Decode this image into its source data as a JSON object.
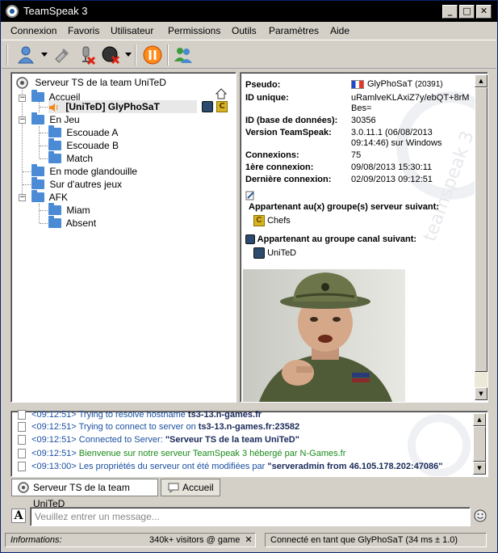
{
  "window": {
    "title": "TeamSpeak 3"
  },
  "menu": [
    "Connexion",
    "Favoris",
    "Utilisateur",
    "Permissions",
    "Outils",
    "Paramètres",
    "Aide"
  ],
  "tree": {
    "server": "Serveur TS de la team UniTeD",
    "channels": [
      {
        "name": "Accueil"
      },
      {
        "name": "[UniTeD] GlyPhoSaT",
        "client": true
      },
      {
        "name": "En Jeu"
      },
      {
        "name": "Escouade A"
      },
      {
        "name": "Escouade B"
      },
      {
        "name": "Match"
      },
      {
        "name": "En mode glandouille"
      },
      {
        "name": "Sur d'autres jeux"
      },
      {
        "name": "AFK"
      },
      {
        "name": "Miam"
      },
      {
        "name": "Absent"
      }
    ],
    "client_badge": "C"
  },
  "info": {
    "labels": {
      "pseudo": "Pseudo:",
      "uid": "ID unique:",
      "dbid": "ID (base de données):",
      "version": "Version TeamSpeak:",
      "connections": "Connexions:",
      "first": "1ère connexion:",
      "last": "Dernière connexion:"
    },
    "pseudo": "GlyPhoSaT",
    "pseudo_id": "(20391)",
    "uid_line1": "uRamlveKLAxiZ7y/ebQT+8rM",
    "uid_line2": "Bes=",
    "dbid": "30356",
    "version_line1": "3.0.11.1 (06/08/2013",
    "version_line2": "09:14:46) sur Windows",
    "connections": "75",
    "first": "09/08/2013 15:30:11",
    "last": "02/09/2013 09:12:51",
    "server_groups_title": "Appartenant au(x) groupe(s) serveur suivant:",
    "server_group": "Chefs",
    "channel_group_title": "Appartenant au groupe canal suivant:",
    "channel_group": "UniTeD",
    "watermark": "teamspeak 3"
  },
  "log": [
    {
      "ts": "<09:12:51>",
      "text": "Trying to resolve hostname ",
      "bold": "ts3-13.n-games.fr",
      "color": "blue"
    },
    {
      "ts": "<09:12:51>",
      "text": "Trying to connect to server on ",
      "bold": "ts3-13.n-games.fr:23582",
      "color": "blue"
    },
    {
      "ts": "<09:12:51>",
      "text": "Connected to Server: ",
      "bold": "\"Serveur TS de la team UniTeD\"",
      "color": "blue"
    },
    {
      "ts": "<09:12:51>",
      "text": "Bienvenue sur notre serveur TeamSpeak 3 hébergé par N-Games.fr",
      "bold": "",
      "color": "green"
    },
    {
      "ts": "<09:13:00>",
      "text": "Les propriétés du serveur ont été modifiées par ",
      "bold": "\"serveradmin from 46.105.178.202:47086\"",
      "color": "blue"
    }
  ],
  "tabs": [
    {
      "label": "Serveur TS de la team UniTeD"
    },
    {
      "label": "Accueil"
    }
  ],
  "chat": {
    "placeholder": "Veuillez entrer un message..."
  },
  "status": {
    "info_label": "Informations:",
    "ticker": "340k+ visitors @ game",
    "connected": "Connecté en tant que GlyPhoSaT (34 ms ± 1.0)"
  },
  "colors": {
    "accent": "#1a4fa0",
    "green": "#1a8a1a",
    "folder": "#4b8bd6"
  }
}
